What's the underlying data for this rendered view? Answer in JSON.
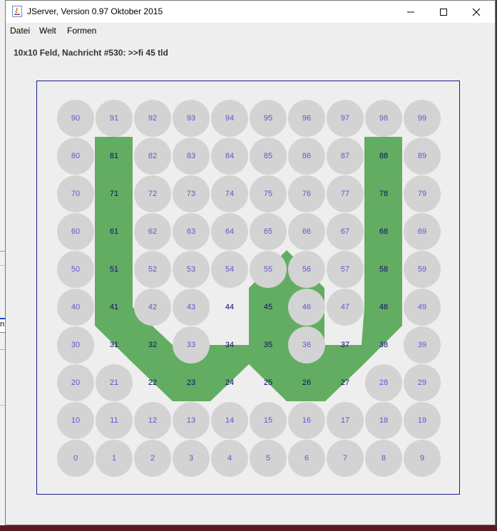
{
  "window": {
    "title": "JServer, Version 0.97 Oktober 2015"
  },
  "menu": {
    "items": [
      "Datei",
      "Welt",
      "Formen"
    ]
  },
  "status": {
    "text": "10x10 Feld, Nachricht #530: >>fi 45 tld"
  },
  "background": {
    "partial_text": "n"
  },
  "board": {
    "cols": 10,
    "rows": 10,
    "border_color": "#1b1b8c",
    "grey_color": "#d3d3d3",
    "green_color": "#62ad62",
    "label_color_grey": "#5a5acf",
    "label_color_green": "#0d0d6b",
    "green_cells": [
      81,
      71,
      61,
      51,
      41,
      31,
      32,
      22,
      23,
      24,
      34,
      44,
      45,
      35,
      25,
      26,
      27,
      37,
      38,
      48,
      58,
      68,
      78,
      88
    ]
  }
}
